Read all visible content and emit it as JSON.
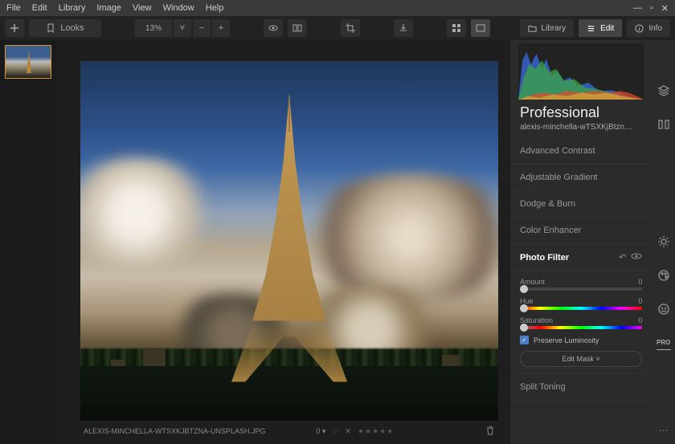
{
  "menu": {
    "file": "File",
    "edit": "Edit",
    "library": "Library",
    "image": "Image",
    "view": "View",
    "window": "Window",
    "help": "Help"
  },
  "toolbar": {
    "looks": "Looks",
    "zoom": "13%",
    "library": "Library",
    "edit": "Edit",
    "info": "Info"
  },
  "panel": {
    "preset": "Professional",
    "filename": "alexis-minchella-wTSXKjBtzn…",
    "tools": {
      "advcontrast": "Advanced Contrast",
      "adjgrad": "Adjustable Gradient",
      "dodge": "Dodge & Burn",
      "colorenh": "Color Enhancer",
      "photofilter": "Photo Filter",
      "splittoning": "Split Toning"
    },
    "sliders": {
      "amount": {
        "label": "Amount",
        "value": "0"
      },
      "hue": {
        "label": "Hue",
        "value": "0"
      },
      "saturation": {
        "label": "Saturation",
        "value": "0"
      }
    },
    "preserve": "Preserve Luminosity",
    "editmask": "Edit Mask ˅"
  },
  "status": {
    "filename": "ALEXIS-MINCHELLA-WTSXKJBTZNA-UNSPLASH.JPG",
    "counter": "0 ▾"
  },
  "sidebar": {
    "pro": "PRO"
  }
}
